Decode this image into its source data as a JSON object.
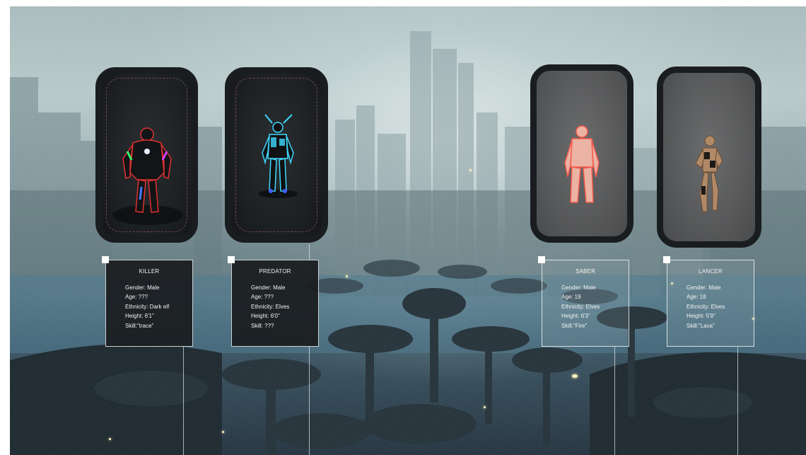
{
  "characters": [
    {
      "name": "KILLER",
      "gender": "Gender: Male",
      "age": "Age: ???",
      "ethnicity": "Ethnicity: Dark elf",
      "height": "Height: 6'1\"",
      "skill": "Skill:\"trace\""
    },
    {
      "name": "PREDATOR",
      "gender": "Gender: Male",
      "age": "Age: ???",
      "ethnicity": "Ethnicity: Elves",
      "height": "Height: 6'0\"",
      "skill": "Skill: ???"
    },
    {
      "name": "SABER",
      "gender": "Gender: Male",
      "age": "Age: 19",
      "ethnicity": "Ethnicity: Elves",
      "height": "Height: 6'3\"",
      "skill": "Skill:\"Fire\""
    },
    {
      "name": "LANCER",
      "gender": "Gender: Male",
      "age": "Age: 18",
      "ethnicity": "Ethnicity: Elves",
      "height": "Height: 5'9\"",
      "skill": "Skill:\"Lava\""
    }
  ],
  "colors": {
    "card_frame": "#1a1d20",
    "killer_glow": "#e03030",
    "predator_glow": "#3fd8ff",
    "saber_glow": "#ff7a6a",
    "lancer_tone": "#b08a68"
  }
}
